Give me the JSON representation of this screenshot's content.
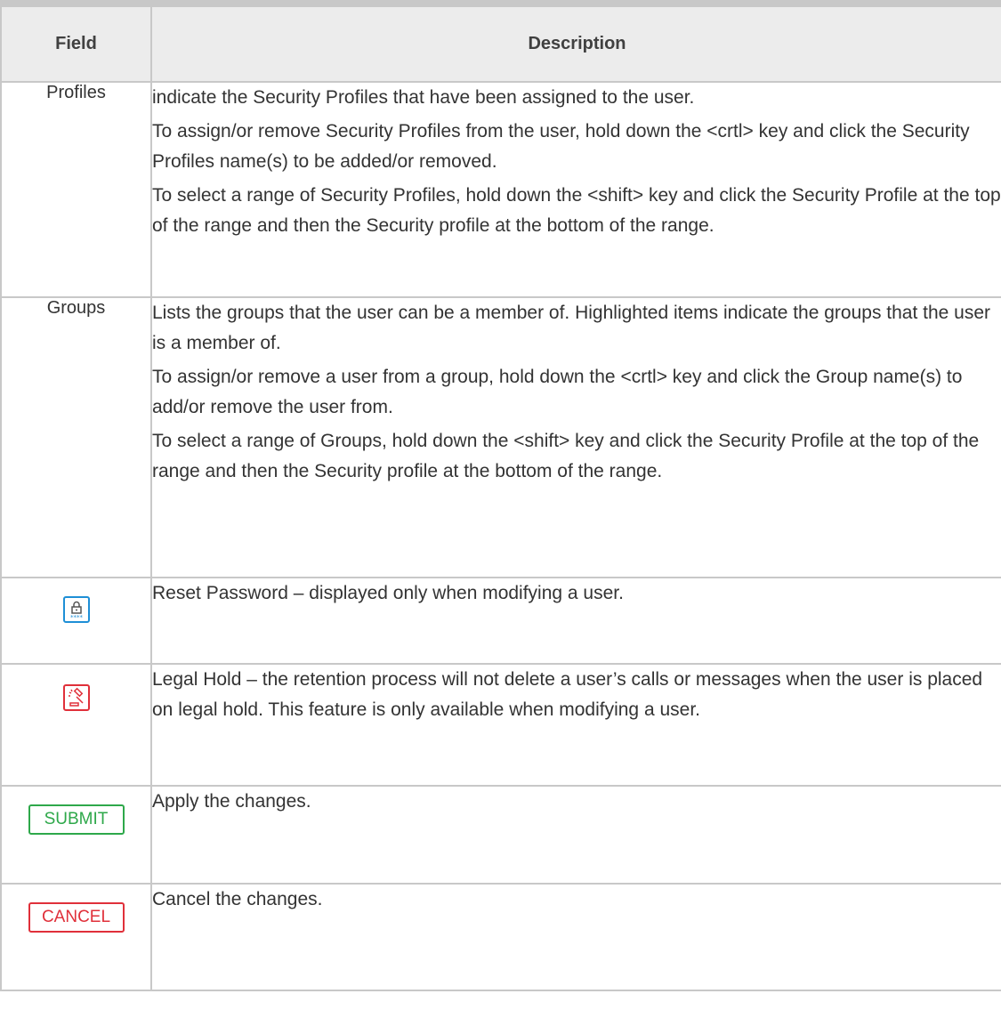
{
  "table": {
    "header": {
      "field": "Field",
      "description": "Description"
    },
    "rows": [
      {
        "field": "Profiles",
        "paragraphs": [
          "indicate the Security Profiles that have been assigned to the user.",
          "To assign/or remove Security Profiles from the user, hold down the <crtl> key and click the Security Profiles name(s) to be added/or removed.",
          "To select a range of Security Profiles, hold down the <shift> key and click the Security Profile at the top of the range and then the Security profile at the bottom of the range."
        ]
      },
      {
        "field": "Groups",
        "paragraphs": [
          "Lists the groups that the user can be a member of. Highlighted items indicate the groups that the user is a member of.",
          "To assign/or remove a user from a group, hold down the <crtl> key and click the Group name(s) to add/or remove the user from.",
          "To select a range of Groups, hold down the <shift> key and click the Security Profile at the top of the range and then the Security profile at the  bottom of the range."
        ]
      },
      {
        "field_icon": "lock-password-icon",
        "icon_color": "#1e8fd6",
        "paragraphs": [
          "Reset Password – displayed only when modifying a user."
        ]
      },
      {
        "field_icon": "gavel-legal-hold-icon",
        "icon_color": "#e0303a",
        "paragraphs": [
          "Legal Hold – the retention process will not delete a user’s calls or messages when the user is placed on legal hold. This feature is only available when modifying a user."
        ]
      },
      {
        "field_button": "SUBMIT",
        "button_color": "#2ea84a",
        "paragraphs": [
          "Apply the changes."
        ]
      },
      {
        "field_button": "CANCEL",
        "button_color": "#e0303a",
        "paragraphs": [
          "Cancel the changes."
        ]
      }
    ]
  }
}
